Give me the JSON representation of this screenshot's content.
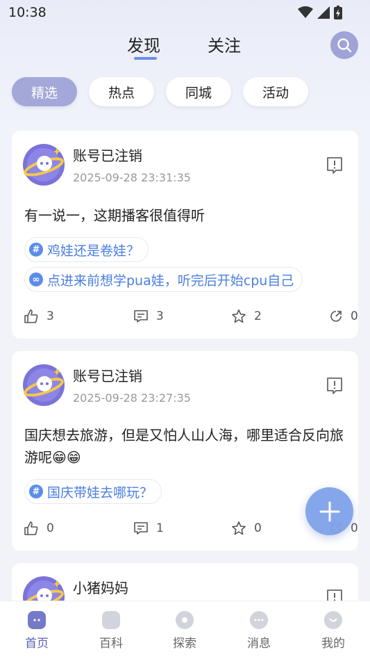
{
  "status": {
    "time": "10:38"
  },
  "top_tabs": [
    "发现",
    "关注"
  ],
  "filters": [
    "精选",
    "热点",
    "同城",
    "活动"
  ],
  "posts": [
    {
      "username": "账号已注销",
      "timestamp": "2025-09-28 23:31:35",
      "content": "有一说一，这期播客很值得听",
      "tags": [
        "鸡娃还是卷娃？",
        "点进来前想学pua娃，听完后开始cpu自己"
      ],
      "likes": "3",
      "comments": "3",
      "favorites": "2",
      "shares": "0"
    },
    {
      "username": "账号已注销",
      "timestamp": "2025-09-28 23:27:35",
      "content": "国庆想去旅游，但是又怕人山人海，哪里适合反向旅游呢😁😁",
      "tags": [
        "国庆带娃去哪玩？"
      ],
      "likes": "0",
      "comments": "1",
      "favorites": "0",
      "shares": "0"
    },
    {
      "username": "小猪妈妈"
    }
  ],
  "bottom_nav": [
    "首页",
    "百科",
    "探索",
    "消息",
    "我的"
  ],
  "colors": {
    "accent": "#6f8de6",
    "chip_active": "#a3a8d9",
    "tag_text": "#4a7ee0",
    "fab": "#7fa2ea"
  }
}
